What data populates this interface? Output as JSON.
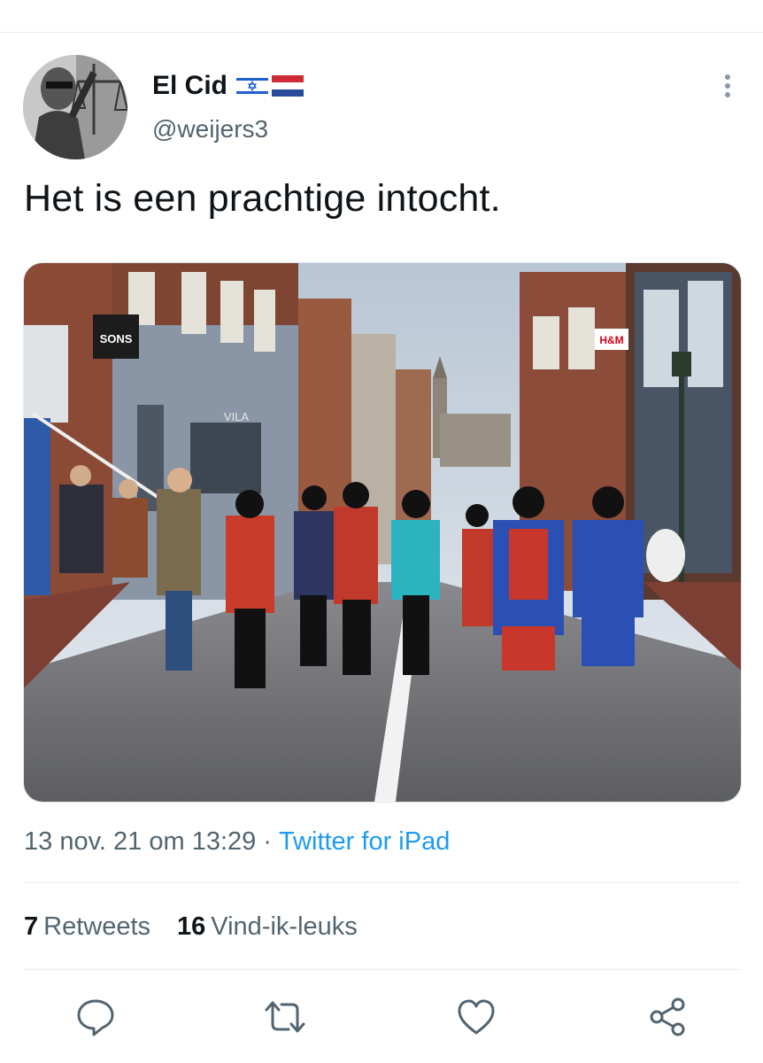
{
  "author": {
    "display_name": "El Cid",
    "handle": "@weijers3",
    "flags": [
      "israel-flag",
      "netherlands-flag"
    ]
  },
  "tweet": {
    "text": "Het is een prachtige intocht.",
    "image": {
      "shop_signs": [
        "SONS",
        "VILA",
        "H&M"
      ]
    }
  },
  "meta": {
    "timestamp": "13 nov. 21 om 13:29",
    "separator": "·",
    "source": "Twitter for iPad"
  },
  "stats": {
    "retweets_count": "7",
    "retweets_label": "Retweets",
    "likes_count": "16",
    "likes_label": "Vind-ik-leuks"
  },
  "actions": [
    "reply-icon",
    "retweet-icon",
    "like-icon",
    "share-icon"
  ],
  "colors": {
    "accent": "#1d9bf0",
    "secondary_text": "#536471",
    "primary_text": "#0f1419",
    "divider": "#e6ecf0"
  }
}
